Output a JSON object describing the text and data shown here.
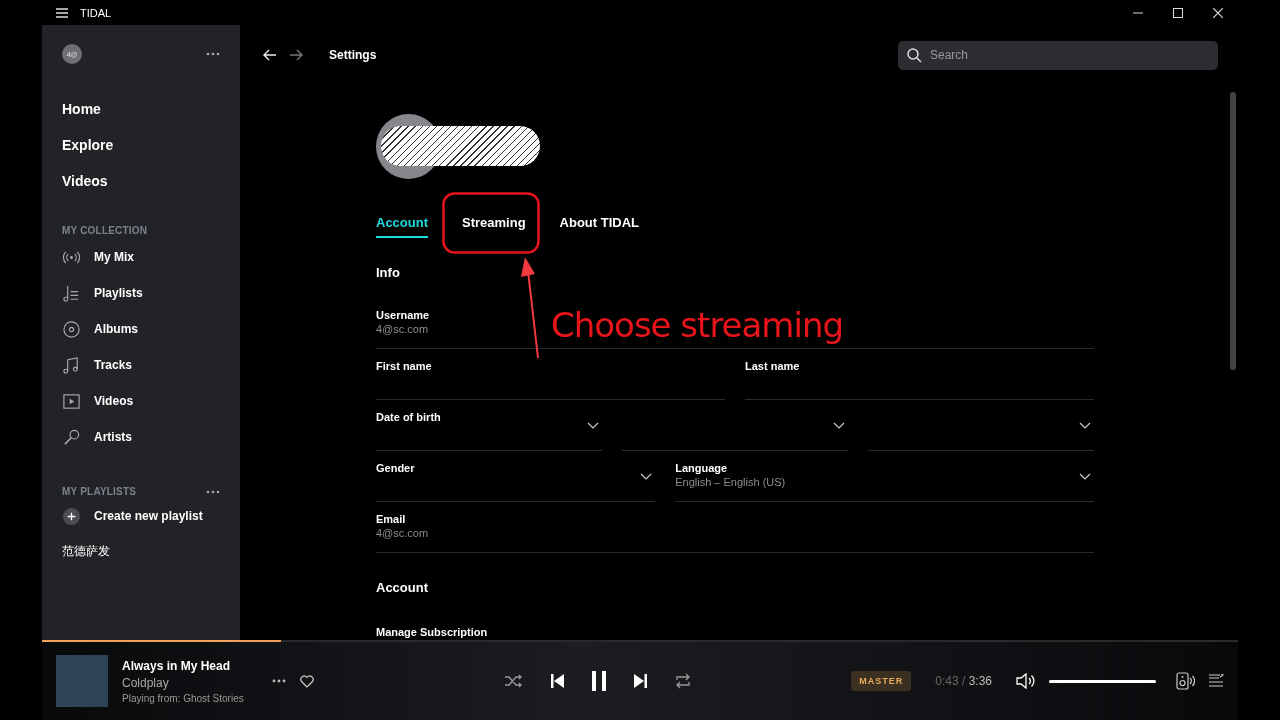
{
  "titlebar": {
    "app_name": "TIDAL"
  },
  "sidebar": {
    "avatar_initials": "4@",
    "nav": [
      "Home",
      "Explore",
      "Videos"
    ],
    "collection_heading": "MY COLLECTION",
    "collection": [
      {
        "label": "My Mix",
        "kind": "mix"
      },
      {
        "label": "Playlists",
        "kind": "playlists"
      },
      {
        "label": "Albums",
        "kind": "albums"
      },
      {
        "label": "Tracks",
        "kind": "tracks"
      },
      {
        "label": "Videos",
        "kind": "videos"
      },
      {
        "label": "Artists",
        "kind": "artists"
      }
    ],
    "playlists_heading": "MY PLAYLISTS",
    "create_playlist": "Create new playlist",
    "playlists": [
      "范德萨发"
    ]
  },
  "header": {
    "title": "Settings",
    "search": {
      "placeholder": "Search"
    }
  },
  "tabs": [
    {
      "label": "Account",
      "selected": true
    },
    {
      "label": "Streaming",
      "selected": false
    },
    {
      "label": "About TIDAL",
      "selected": false
    }
  ],
  "info_heading": "Info",
  "form_rows": [
    [
      {
        "kind": "text",
        "label": "Username",
        "value": "4@sc.com"
      }
    ],
    [
      {
        "kind": "text",
        "label": "First name"
      },
      {
        "kind": "text",
        "label": "Last name"
      }
    ],
    [
      {
        "kind": "select",
        "label": "Date of birth"
      },
      {
        "kind": "select"
      },
      {
        "kind": "select"
      }
    ],
    [
      {
        "kind": "select",
        "label": "Gender"
      },
      {
        "kind": "select",
        "label": "Language",
        "value": "English – English (US)"
      }
    ],
    [
      {
        "kind": "text",
        "label": "Email",
        "value": "4@sc.com"
      }
    ]
  ],
  "account_heading": "Account",
  "manage_subscription": "Manage Subscription",
  "player": {
    "progress": {
      "level": 0.2
    },
    "title": "Always in My Head",
    "artist": "Coldplay",
    "playing_from_label": "Playing from:",
    "playing_from": "Ghost Stories",
    "quality": "MASTER",
    "elapsed": "0:43",
    "separator": "/",
    "duration": "3:36",
    "volume": {
      "level": 1
    }
  },
  "annotation": {
    "text": "Choose streaming"
  }
}
